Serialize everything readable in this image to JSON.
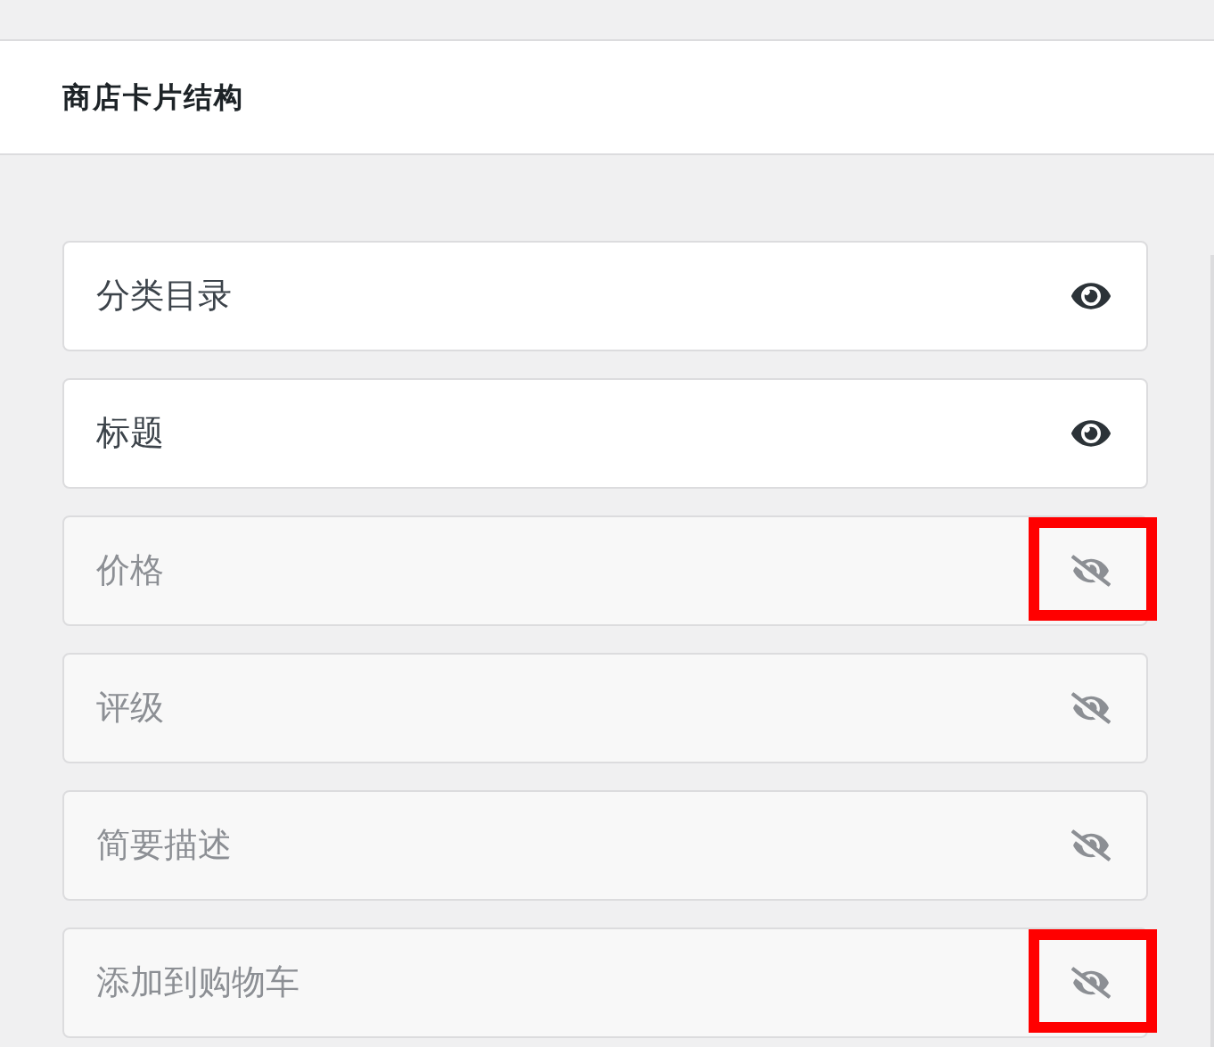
{
  "header": {
    "title": "商店卡片结构"
  },
  "items": [
    {
      "label": "分类目录",
      "visible": true,
      "highlighted": false
    },
    {
      "label": "标题",
      "visible": true,
      "highlighted": false
    },
    {
      "label": "价格",
      "visible": false,
      "highlighted": true
    },
    {
      "label": "评级",
      "visible": false,
      "highlighted": false
    },
    {
      "label": "简要描述",
      "visible": false,
      "highlighted": false
    },
    {
      "label": "添加到购物车",
      "visible": false,
      "highlighted": true
    }
  ]
}
